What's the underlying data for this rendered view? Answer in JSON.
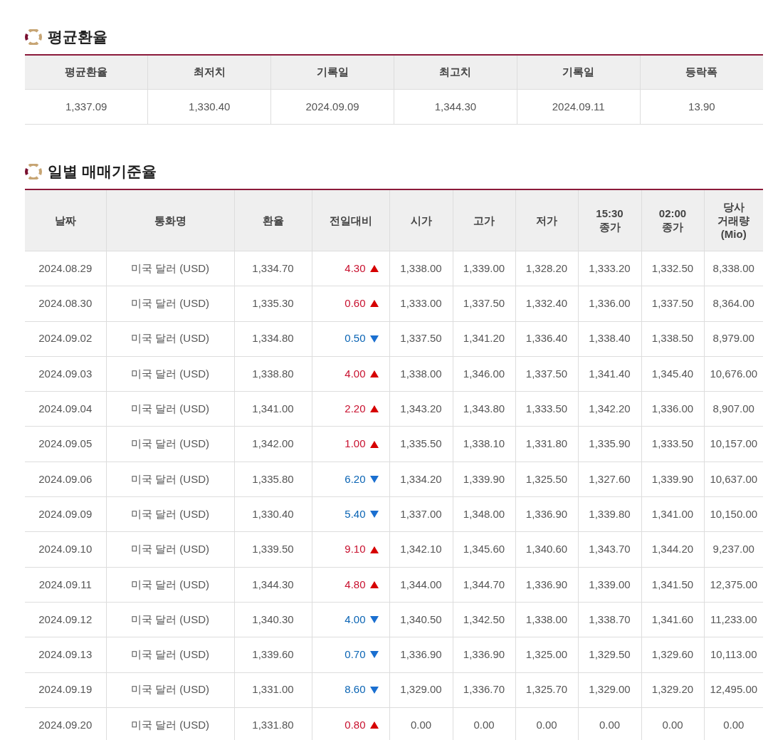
{
  "summary": {
    "title": "평균환율",
    "columns": [
      "평균환율",
      "최저치",
      "기록일",
      "최고치",
      "기록일",
      "등락폭"
    ],
    "values": [
      "1,337.09",
      "1,330.40",
      "2024.09.09",
      "1,344.30",
      "2024.09.11",
      "13.90"
    ]
  },
  "daily": {
    "title": "일별 매매기준율",
    "columns": [
      "날짜",
      "통화명",
      "환율",
      "전일대비",
      "시가",
      "고가",
      "저가",
      "15:30\n종가",
      "02:00\n종가",
      "당사\n거래량\n(Mio)"
    ],
    "rows": [
      {
        "date": "2024.08.29",
        "currency": "미국 달러 (USD)",
        "rate": "1,334.70",
        "change": "4.30",
        "kind": "up",
        "open": "1,338.00",
        "high": "1,339.00",
        "low": "1,328.20",
        "close1530": "1,333.20",
        "close0200": "1,332.50",
        "volume": "8,338.00"
      },
      {
        "date": "2024.08.30",
        "currency": "미국 달러 (USD)",
        "rate": "1,335.30",
        "change": "0.60",
        "kind": "up",
        "open": "1,333.00",
        "high": "1,337.50",
        "low": "1,332.40",
        "close1530": "1,336.00",
        "close0200": "1,337.50",
        "volume": "8,364.00"
      },
      {
        "date": "2024.09.02",
        "currency": "미국 달러 (USD)",
        "rate": "1,334.80",
        "change": "0.50",
        "kind": "down",
        "open": "1,337.50",
        "high": "1,341.20",
        "low": "1,336.40",
        "close1530": "1,338.40",
        "close0200": "1,338.50",
        "volume": "8,979.00"
      },
      {
        "date": "2024.09.03",
        "currency": "미국 달러 (USD)",
        "rate": "1,338.80",
        "change": "4.00",
        "kind": "up",
        "open": "1,338.00",
        "high": "1,346.00",
        "low": "1,337.50",
        "close1530": "1,341.40",
        "close0200": "1,345.40",
        "volume": "10,676.00"
      },
      {
        "date": "2024.09.04",
        "currency": "미국 달러 (USD)",
        "rate": "1,341.00",
        "change": "2.20",
        "kind": "up",
        "open": "1,343.20",
        "high": "1,343.80",
        "low": "1,333.50",
        "close1530": "1,342.20",
        "close0200": "1,336.00",
        "volume": "8,907.00"
      },
      {
        "date": "2024.09.05",
        "currency": "미국 달러 (USD)",
        "rate": "1,342.00",
        "change": "1.00",
        "kind": "up",
        "open": "1,335.50",
        "high": "1,338.10",
        "low": "1,331.80",
        "close1530": "1,335.90",
        "close0200": "1,333.50",
        "volume": "10,157.00"
      },
      {
        "date": "2024.09.06",
        "currency": "미국 달러 (USD)",
        "rate": "1,335.80",
        "change": "6.20",
        "kind": "down",
        "open": "1,334.20",
        "high": "1,339.90",
        "low": "1,325.50",
        "close1530": "1,327.60",
        "close0200": "1,339.90",
        "volume": "10,637.00"
      },
      {
        "date": "2024.09.09",
        "currency": "미국 달러 (USD)",
        "rate": "1,330.40",
        "change": "5.40",
        "kind": "down",
        "open": "1,337.00",
        "high": "1,348.00",
        "low": "1,336.90",
        "close1530": "1,339.80",
        "close0200": "1,341.00",
        "volume": "10,150.00"
      },
      {
        "date": "2024.09.10",
        "currency": "미국 달러 (USD)",
        "rate": "1,339.50",
        "change": "9.10",
        "kind": "up",
        "open": "1,342.10",
        "high": "1,345.60",
        "low": "1,340.60",
        "close1530": "1,343.70",
        "close0200": "1,344.20",
        "volume": "9,237.00"
      },
      {
        "date": "2024.09.11",
        "currency": "미국 달러 (USD)",
        "rate": "1,344.30",
        "change": "4.80",
        "kind": "up",
        "open": "1,344.00",
        "high": "1,344.70",
        "low": "1,336.90",
        "close1530": "1,339.00",
        "close0200": "1,341.50",
        "volume": "12,375.00"
      },
      {
        "date": "2024.09.12",
        "currency": "미국 달러 (USD)",
        "rate": "1,340.30",
        "change": "4.00",
        "kind": "down",
        "open": "1,340.50",
        "high": "1,342.50",
        "low": "1,338.00",
        "close1530": "1,338.70",
        "close0200": "1,341.60",
        "volume": "11,233.00"
      },
      {
        "date": "2024.09.13",
        "currency": "미국 달러 (USD)",
        "rate": "1,339.60",
        "change": "0.70",
        "kind": "down",
        "open": "1,336.90",
        "high": "1,336.90",
        "low": "1,325.00",
        "close1530": "1,329.50",
        "close0200": "1,329.60",
        "volume": "10,113.00"
      },
      {
        "date": "2024.09.19",
        "currency": "미국 달러 (USD)",
        "rate": "1,331.00",
        "change": "8.60",
        "kind": "down",
        "open": "1,329.00",
        "high": "1,336.70",
        "low": "1,325.70",
        "close1530": "1,329.00",
        "close0200": "1,329.20",
        "volume": "12,495.00"
      },
      {
        "date": "2024.09.20",
        "currency": "미국 달러 (USD)",
        "rate": "1,331.80",
        "change": "0.80",
        "kind": "up",
        "open": "0.00",
        "high": "0.00",
        "low": "0.00",
        "close1530": "0.00",
        "close0200": "0.00",
        "volume": "0.00"
      }
    ]
  }
}
